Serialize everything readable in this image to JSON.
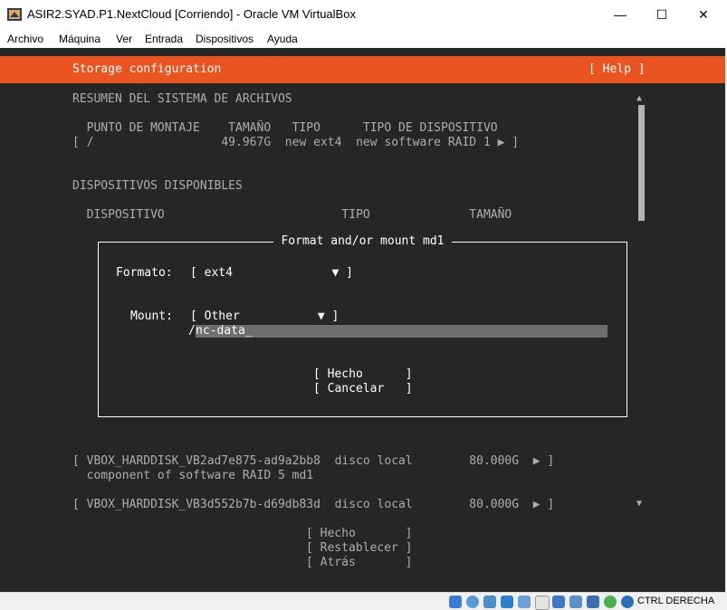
{
  "window": {
    "title": "ASIR2.SYAD.P1.NextCloud [Corriendo] - Oracle VM VirtualBox",
    "minimize_glyph": "—",
    "maximize_glyph": "☐",
    "close_glyph": "✕"
  },
  "menu": [
    "Archivo",
    "Máquina",
    "Ver",
    "Entrada",
    "Dispositivos",
    "Ayuda"
  ],
  "installer": {
    "header_title": "Storage configuration",
    "help_label": "[ Help ]",
    "summary_heading": "RESUMEN DEL SISTEMA DE ARCHIVOS",
    "summary_columns": "  PUNTO DE MONTAJE    TAMAÑO   TIPO      TIPO DE DISPOSITIVO",
    "summary_row": "[ /                  49.967G  new ext4  new software RAID 1 ▶ ]",
    "scroll_up": "▲",
    "available_heading": "DISPOSITIVOS DISPONIBLES",
    "available_columns": "  DISPOSITIVO                         TIPO              TAMAÑO",
    "device_rows": [
      "[ VBOX_HARDDISK_VB2ad7e875-ad9a2bb8  disco local        80.000G  ▶ ]",
      "  component of software RAID 5 md1",
      "[ VBOX_HARDDISK_VB3d552b7b-d69db83d  disco local        80.000G  ▶ ]"
    ],
    "scroll_down": "▼",
    "bottom_buttons": [
      "[ Hecho       ]",
      "[ Restablecer ]",
      "[ Atrás       ]"
    ]
  },
  "dialog": {
    "title": "Format and/or mount md1",
    "format_label": "Formato:",
    "format_value": "[ ext4              ▼ ]",
    "mount_label": "Mount:",
    "mount_value": "[ Other           ▼ ]",
    "path_prefix": "/",
    "path_value": "nc-data",
    "cursor": "_",
    "done_button": "[ Hecho      ]",
    "cancel_button": "[ Cancelar   ]"
  },
  "statusbar": {
    "host_key": "CTRL DERECHA"
  },
  "colors": {
    "accent_orange": "#e95420",
    "terminal_bg": "#262626",
    "field_bg": "#6e6e6e"
  }
}
